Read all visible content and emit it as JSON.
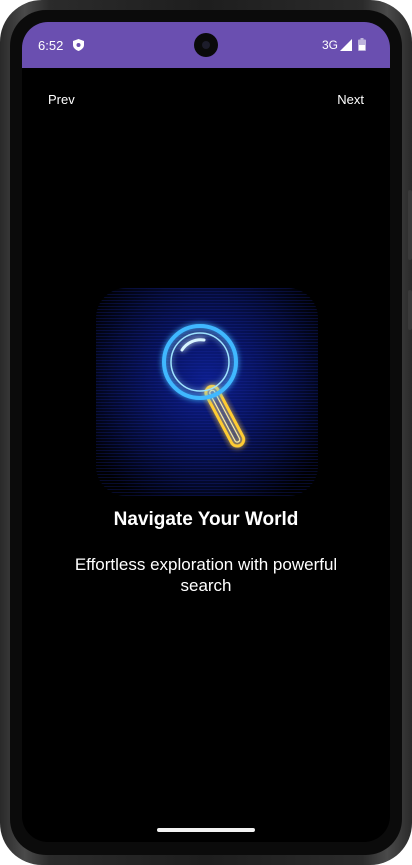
{
  "status_bar": {
    "time": "6:52",
    "network": "3G",
    "shield_icon": "shield-icon",
    "signal_icon": "signal-icon",
    "battery_icon": "battery-icon",
    "color": "#6a4fb0"
  },
  "nav": {
    "prev_label": "Prev",
    "next_label": "Next"
  },
  "onboarding": {
    "illustration_icon": "magnifying-glass-icon",
    "title": "Navigate Your World",
    "subtitle": "Effortless exploration with powerful search"
  },
  "colors": {
    "background": "#000000",
    "neon_blue": "#3fb8ff",
    "neon_gold": "#ffcc33"
  }
}
